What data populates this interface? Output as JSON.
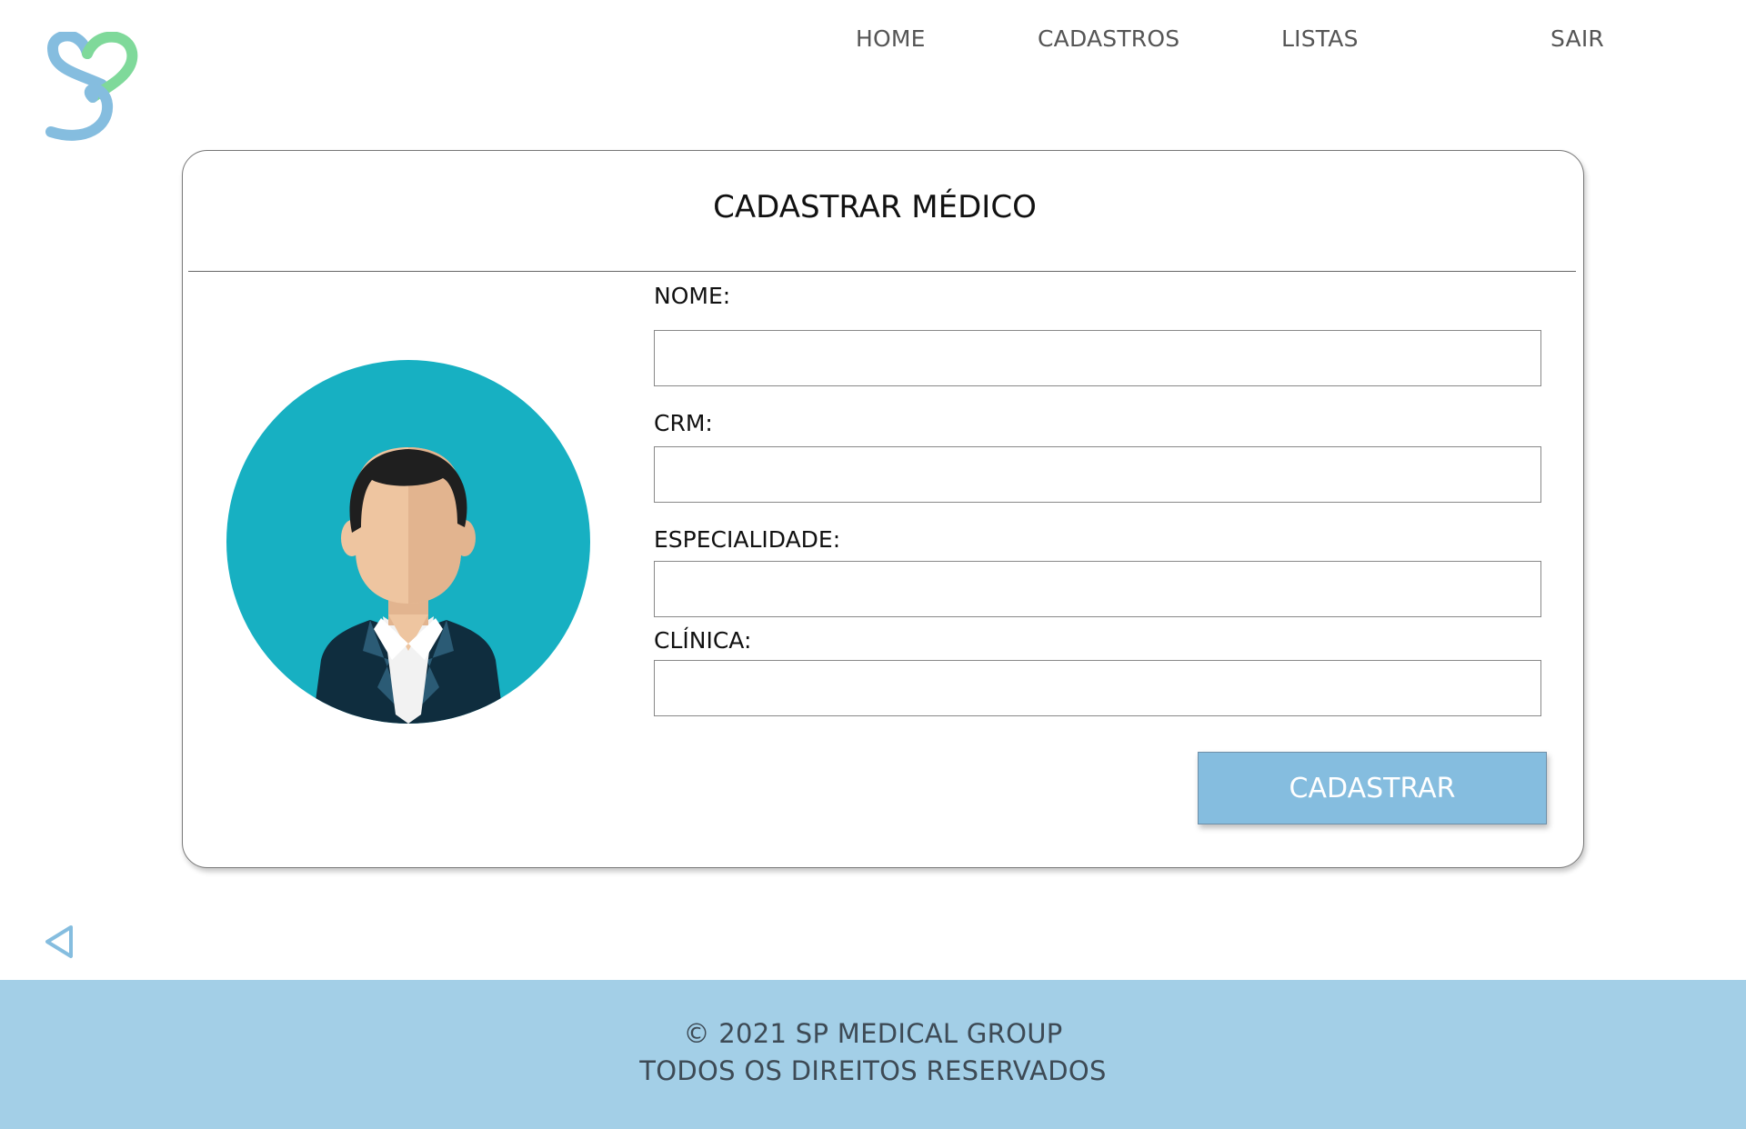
{
  "brand": {
    "logo_icon": "heart-s-logo-icon",
    "colors": {
      "logo_blue": "#85bddf",
      "logo_green": "#7fd99a"
    }
  },
  "nav": {
    "items": [
      {
        "label": "HOME"
      },
      {
        "label": "CADASTROS"
      },
      {
        "label": "LISTAS"
      },
      {
        "label": "SAIR"
      }
    ]
  },
  "form": {
    "title": "CADASTRAR MÉDICO",
    "avatar_icon": "doctor-avatar-icon",
    "fields": [
      {
        "label": "NOME:",
        "value": ""
      },
      {
        "label": "CRM:",
        "value": ""
      },
      {
        "label": "ESPECIALIDADE:",
        "value": ""
      },
      {
        "label": "CLÍNICA:",
        "value": ""
      }
    ],
    "submit_label": "CADASTRAR"
  },
  "back_icon": "back-triangle-icon",
  "footer": {
    "line1": "© 2021 SP MEDICAL GROUP",
    "line2": "TODOS OS DIREITOS RESERVADOS"
  },
  "colors": {
    "accent": "#85bddf",
    "footer_bg": "#a3cfe7",
    "avatar_bg": "#17b0c2"
  }
}
